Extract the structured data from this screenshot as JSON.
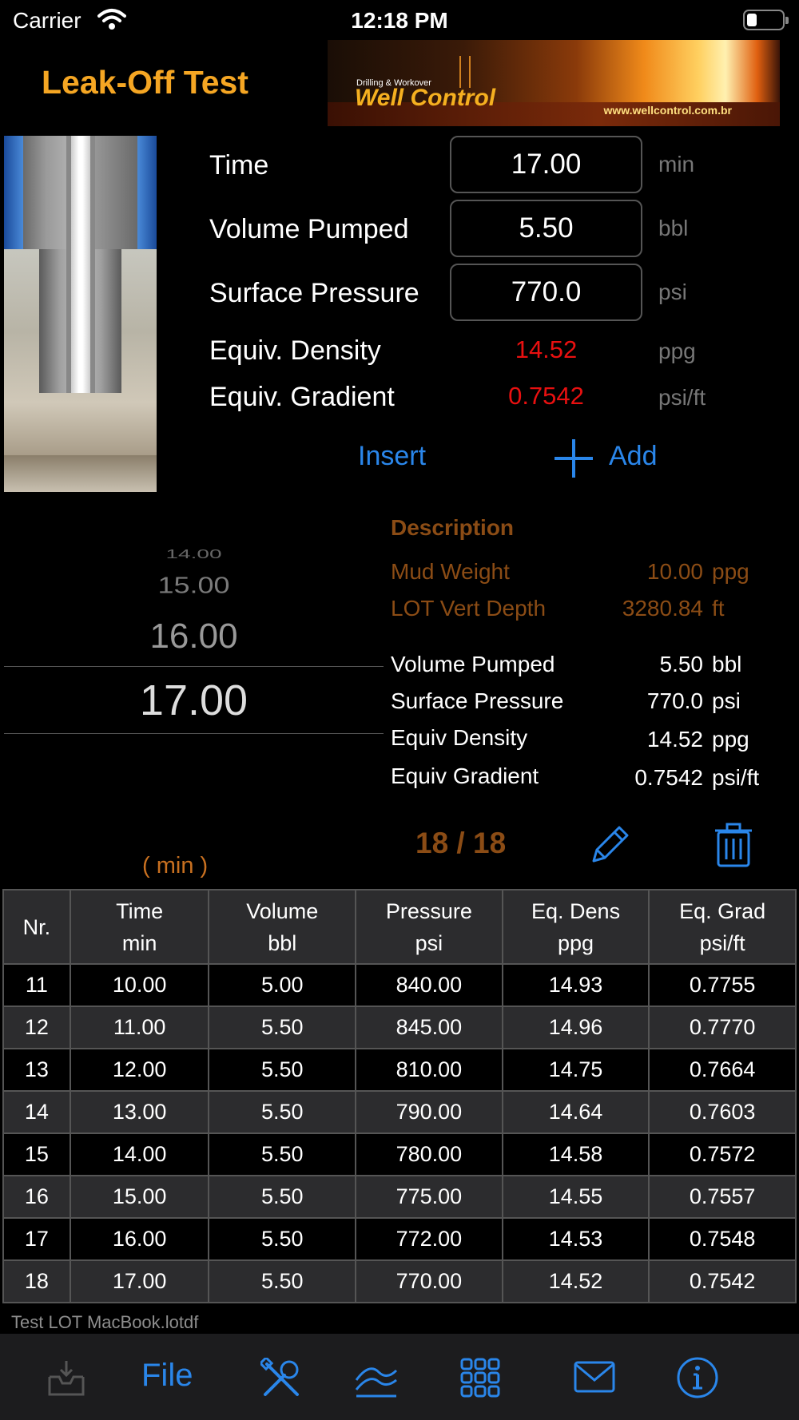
{
  "status": {
    "carrier": "Carrier",
    "time": "12:18 PM"
  },
  "header": {
    "title": "Leak-Off Test",
    "banner_small": "Drilling & Workover",
    "banner_brand": "Well Control",
    "banner_url": "www.wellcontrol.com.br"
  },
  "inputs": {
    "time": {
      "label": "Time",
      "value": "17.00",
      "unit": "min"
    },
    "volume": {
      "label": "Volume Pumped",
      "value": "5.50",
      "unit": "bbl"
    },
    "pressure": {
      "label": "Surface Pressure",
      "value": "770.0",
      "unit": "psi"
    }
  },
  "computed": {
    "density": {
      "label": "Equiv. Density",
      "value": "14.52",
      "unit": "ppg"
    },
    "gradient": {
      "label": "Equiv. Gradient",
      "value": "0.7542",
      "unit": "psi/ft"
    }
  },
  "actions": {
    "insert": "Insert",
    "add": "Add"
  },
  "picker": {
    "items": [
      "14.00",
      "15.00",
      "16.00",
      "17.00"
    ],
    "unit": "(   min   )"
  },
  "description": {
    "title": "Description",
    "mud_weight": {
      "label": "Mud Weight",
      "value": "10.00",
      "unit": "ppg"
    },
    "lot_depth": {
      "label": "LOT Vert Depth",
      "value": "3280.84",
      "unit": "ft"
    },
    "volume": {
      "label": "Volume Pumped",
      "value": "5.50",
      "unit": "bbl"
    },
    "pressure": {
      "label": "Surface Pressure",
      "value": "770.0",
      "unit": "psi"
    },
    "density": {
      "label": "Equiv Density",
      "value": "14.52",
      "unit": "ppg"
    },
    "gradient": {
      "label": "Equiv Gradient",
      "value": "0.7542",
      "unit": "psi/ft"
    }
  },
  "record_counter": "18 / 18",
  "table": {
    "headers": [
      {
        "l1": "Nr.",
        "l2": ""
      },
      {
        "l1": "Time",
        "l2": "min"
      },
      {
        "l1": "Volume",
        "l2": "bbl"
      },
      {
        "l1": "Pressure",
        "l2": "psi"
      },
      {
        "l1": "Eq. Dens",
        "l2": "ppg"
      },
      {
        "l1": "Eq. Grad",
        "l2": "psi/ft"
      }
    ],
    "rows": [
      [
        "11",
        "10.00",
        "5.00",
        "840.00",
        "14.93",
        "0.7755"
      ],
      [
        "12",
        "11.00",
        "5.50",
        "845.00",
        "14.96",
        "0.7770"
      ],
      [
        "13",
        "12.00",
        "5.50",
        "810.00",
        "14.75",
        "0.7664"
      ],
      [
        "14",
        "13.00",
        "5.50",
        "790.00",
        "14.64",
        "0.7603"
      ],
      [
        "15",
        "14.00",
        "5.50",
        "780.00",
        "14.58",
        "0.7572"
      ],
      [
        "16",
        "15.00",
        "5.50",
        "775.00",
        "14.55",
        "0.7557"
      ],
      [
        "17",
        "16.00",
        "5.50",
        "772.00",
        "14.53",
        "0.7548"
      ],
      [
        "18",
        "17.00",
        "5.50",
        "770.00",
        "14.52",
        "0.7542"
      ]
    ]
  },
  "filename": "Test LOT MacBook.lotdf",
  "tabbar": {
    "file_label": "File"
  },
  "colors": {
    "accent": "#2a86ea",
    "title_orange": "#f5a623",
    "brown": "#8b4c15",
    "alert_red": "#e81010"
  },
  "icons": [
    "wifi-icon",
    "battery-icon",
    "plus-icon",
    "pencil-icon",
    "trash-icon",
    "inbox-icon",
    "tools-icon",
    "chart-icon",
    "grid-icon",
    "mail-icon",
    "info-icon"
  ]
}
